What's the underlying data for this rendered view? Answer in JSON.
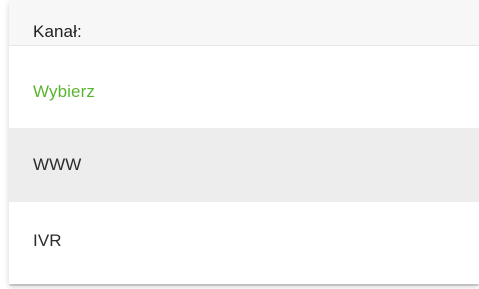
{
  "dropdown": {
    "label": "Kanał:",
    "options": [
      {
        "label": "Wybierz",
        "state": "placeholder"
      },
      {
        "label": "WWW",
        "state": "hovered"
      },
      {
        "label": "IVR",
        "state": "default"
      }
    ]
  },
  "colors": {
    "placeholder_text": "#5cb531",
    "hover_background": "#ededed",
    "label_background": "#f7f7f7"
  }
}
